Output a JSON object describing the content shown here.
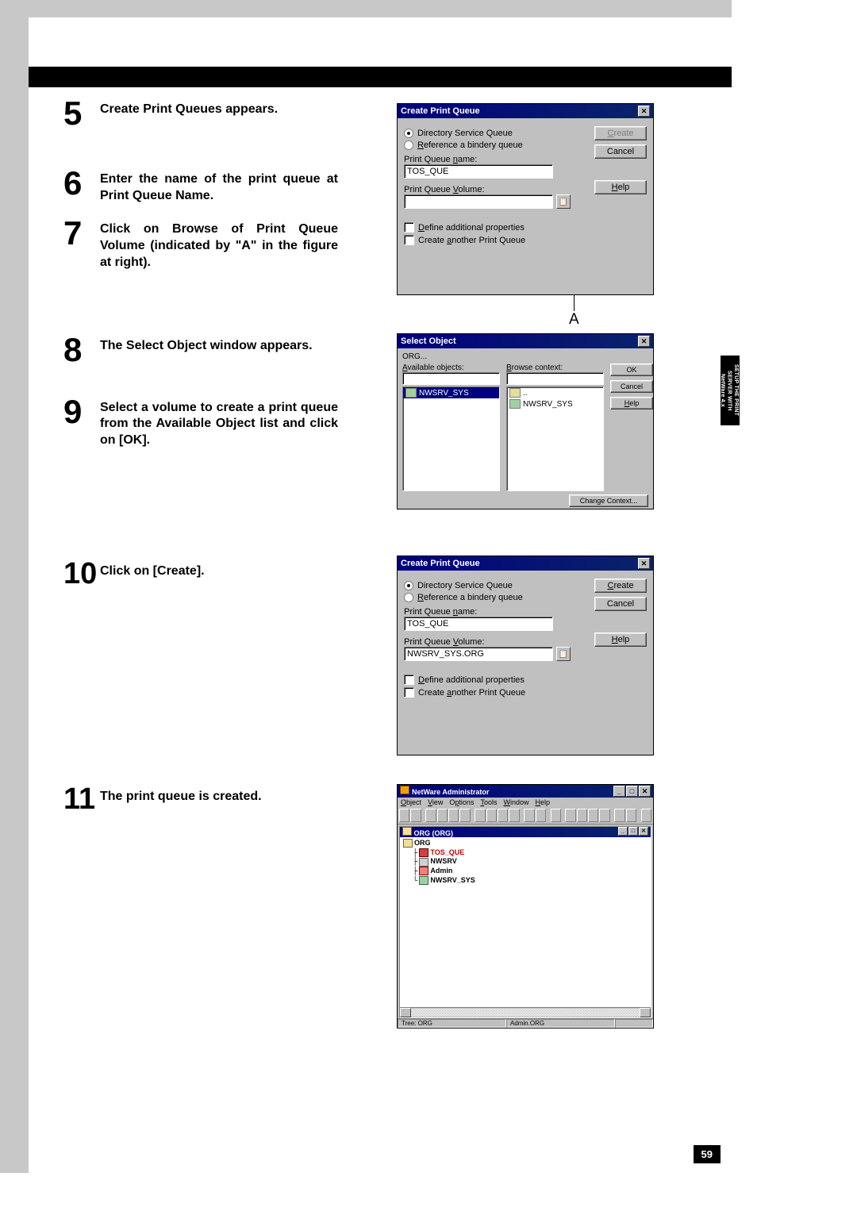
{
  "page_number": "59",
  "side_tab": "SETUP THE\nPRINT SERVER\nWITH NetWare 4.x",
  "steps": [
    {
      "n": "5",
      "text": "Create Print Queues appears."
    },
    {
      "n": "6",
      "text": "Enter the name of the print queue at Print Queue Name."
    },
    {
      "n": "7",
      "text": "Click on Browse of Print Queue Volume (indicated by \"A\" in the figure at right)."
    },
    {
      "n": "8",
      "text": "The Select Object window appears."
    },
    {
      "n": "9",
      "text": "Select a volume to create a print queue from the Available Object list and click on [OK]."
    },
    {
      "n": "10",
      "text": "Click on [Create]."
    },
    {
      "n": "11",
      "text": "The print queue is created."
    }
  ],
  "dlg1": {
    "title": "Create Print Queue",
    "radio1": "Directory Service Queue",
    "radio2": "Reference a bindery queue",
    "name_label": "Print Queue name:",
    "name_value": "TOS_QUE",
    "vol_label": "Print Queue Volume:",
    "vol_value": "",
    "chk1": "Define additional properties",
    "chk2": "Create another Print Queue",
    "create_btn": "Create",
    "cancel_btn": "Cancel",
    "help_btn": "Help",
    "a_marker": "A"
  },
  "dlg2": {
    "title": "Select Object",
    "context": "ORG...",
    "avail_label": "Available objects:",
    "browse_label": "Browse context:",
    "avail_item": "NWSRV_SYS",
    "browse_item1": "..",
    "browse_item2": "NWSRV_SYS",
    "ok_btn": "OK",
    "cancel_btn": "Cancel",
    "help_btn": "Help",
    "change_ctx_btn": "Change Context..."
  },
  "dlg3": {
    "title": "Create Print Queue",
    "radio1": "Directory Service Queue",
    "radio2": "Reference a bindery queue",
    "name_label": "Print Queue name:",
    "name_value": "TOS_QUE",
    "vol_label": "Print Queue Volume:",
    "vol_value": "NWSRV_SYS.ORG",
    "chk1": "Define additional properties",
    "chk2": "Create another Print Queue",
    "create_btn": "Create",
    "cancel_btn": "Cancel",
    "help_btn": "Help"
  },
  "nwadmin": {
    "title": "NetWare Administrator",
    "menus": [
      "Object",
      "View",
      "Options",
      "Tools",
      "Window",
      "Help"
    ],
    "inner_title": "ORG (ORG)",
    "nodes": [
      {
        "icon": "org",
        "label": "ORG",
        "indent": 0,
        "sel": false
      },
      {
        "icon": "queue",
        "label": "TOS_QUE",
        "indent": 1,
        "sel": true
      },
      {
        "icon": "srv",
        "label": "NWSRV",
        "indent": 1,
        "sel": false
      },
      {
        "icon": "adm",
        "label": "Admin",
        "indent": 1,
        "sel": false
      },
      {
        "icon": "vol",
        "label": "NWSRV_SYS",
        "indent": 1,
        "sel": false
      }
    ],
    "status_left": "Tree: ORG",
    "status_right": "Admin.ORG"
  }
}
